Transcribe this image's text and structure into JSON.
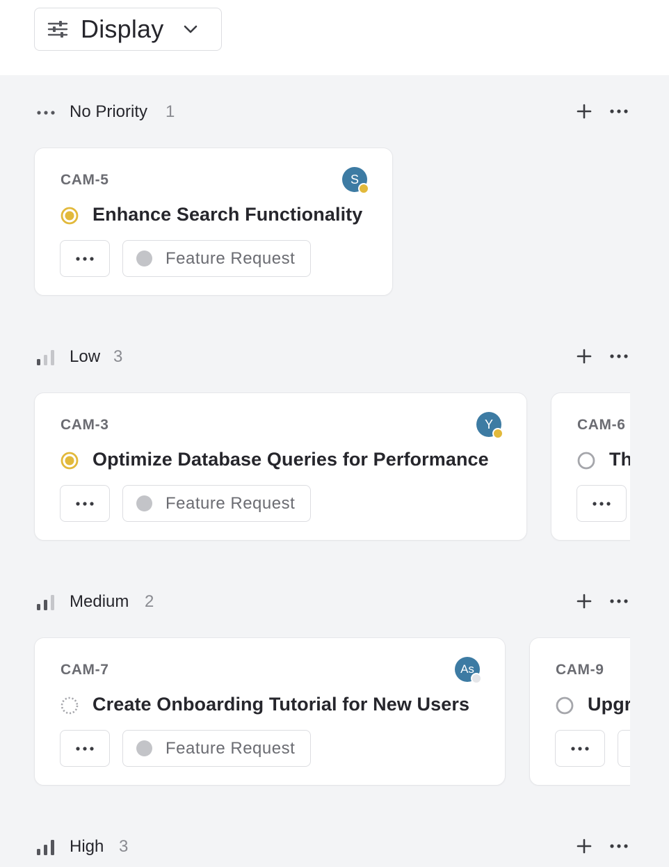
{
  "toolbar": {
    "display_label": "Display",
    "display_icon": "sliders-icon",
    "chevron_icon": "chevron-down-icon"
  },
  "colors": {
    "board_bg": "#f3f4f6",
    "avatar_bg": "#3d7ba3",
    "in_progress": "#e2b93b",
    "label_dot": "#c3c4c8"
  },
  "groups": [
    {
      "name": "No Priority",
      "count": "1",
      "icon": "no-priority-icon",
      "cards": [
        {
          "id": "CAM-5",
          "title": "Enhance Search Functionality",
          "status": "in-progress",
          "avatar": "S",
          "avatar_status": "yellow",
          "label": "Feature Request"
        }
      ]
    },
    {
      "name": "Low",
      "count": "3",
      "icon": "priority-low-icon",
      "cards": [
        {
          "id": "CAM-3",
          "title": "Optimize Database Queries for Performance",
          "status": "in-progress",
          "avatar": "Y",
          "avatar_status": "yellow",
          "label": "Feature Request"
        },
        {
          "id": "CAM-6",
          "title": "Th",
          "status": "todo"
        }
      ]
    },
    {
      "name": "Medium",
      "count": "2",
      "icon": "priority-medium-icon",
      "cards": [
        {
          "id": "CAM-7",
          "title": "Create Onboarding Tutorial for New Users",
          "status": "backlog",
          "avatar": "As",
          "avatar_status": "gray",
          "label": "Feature Request"
        },
        {
          "id": "CAM-9",
          "title": "Upgr",
          "status": "todo"
        }
      ]
    },
    {
      "name": "High",
      "count": "3",
      "icon": "priority-high-icon",
      "cards": []
    }
  ]
}
